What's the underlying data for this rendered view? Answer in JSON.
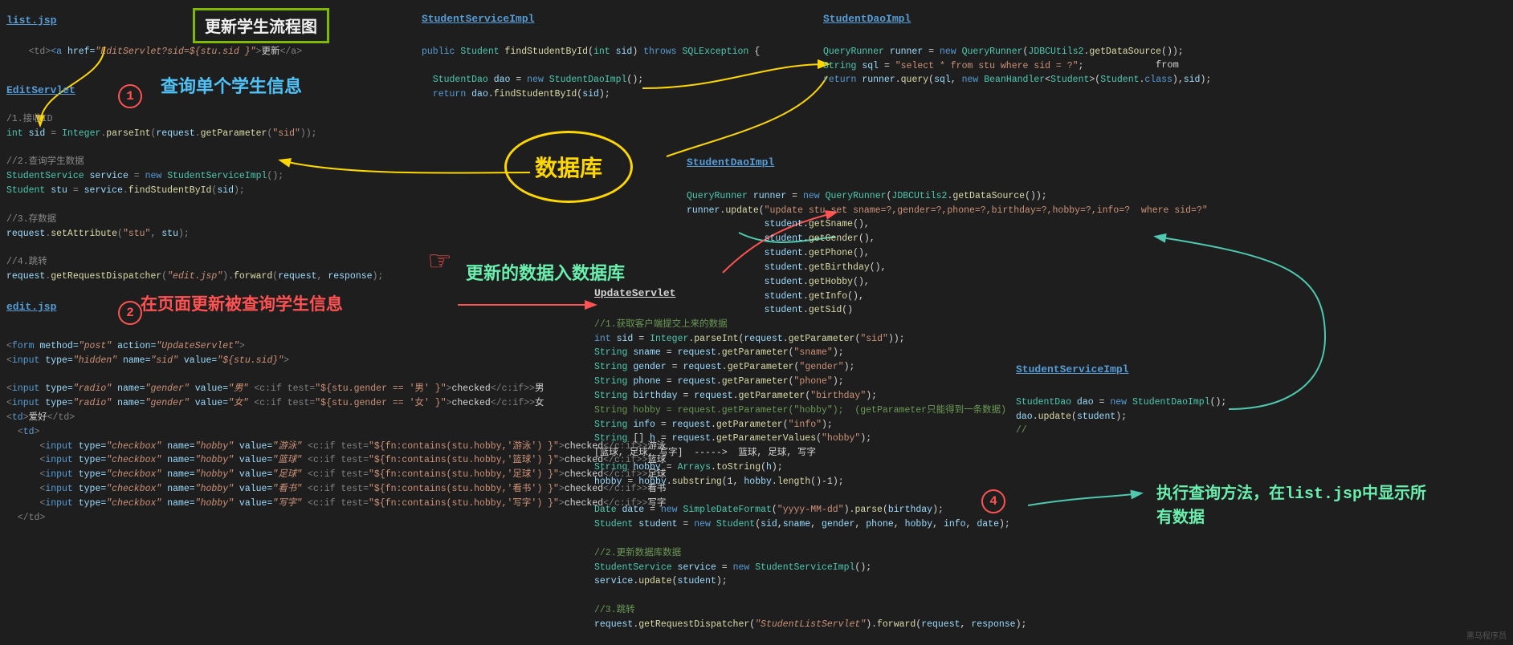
{
  "title": "更新学生流程图",
  "sections": {
    "list_jsp": {
      "label": "list.jsp",
      "code_line": "<td><a href=\"EditServlet?sid=${stu.sid }\">更新</a>"
    },
    "edit_servlet": {
      "label": "EditServlet",
      "subtitle": "查询单个学生信息",
      "code": "/1.接收ID\nint sid = Integer.parseInt(request.getParameter(\"sid\"));\n\n//2.查询学生数据\nStudentService service = new StudentServiceImpl();\nStudent stu = service.findStudentById(sid);\n\n//3.存数据\nrequest.setAttribute(\"stu\", stu);\n\n//4.跳转\nrequest.getRequestDispatcher(\"edit.jsp\").forward(request, response);"
    },
    "student_service_impl_top": {
      "label": "StudentServiceImpl",
      "code": "public Student findStudentById(int sid) throws SQLException {\n\n    StudentDao dao = new StudentDaoImpl();\n    return dao.findStudentById(sid);"
    },
    "student_dao_impl_top": {
      "label": "StudentDaoImpl",
      "code_line1": "QueryRunner runner = new QueryRunner(JDBCUtils2.getDataSource());",
      "code_line2": "String sql = \"select * from stu where sid = ?\";",
      "code_line3": "return runner.query(sql, new BeanHandler<Student>(Student.class),sid);"
    },
    "database": "数据库",
    "student_dao_impl_bottom": {
      "label": "StudentDaoImpl",
      "code_line1": "QueryRunner runner = new QueryRunner(JDBCUtils2.getDataSource());",
      "code_line2": "runner.update(\"update stu set sname=?,gender=?,phone=?,birthday=?,hobby=?,info=?  where sid=?\"",
      "code_methods": "student.getSname(),\nstudent.getGender(),\nstudent.getPhone(),\nstudent.getBirthday(),\nstudent.getHobby(),\nstudent.getInfo(),\nstudent.getSid()"
    },
    "update_data_heading": "更新的数据入数据库",
    "update_servlet": {
      "label": "UpdateServlet",
      "comment1": "//1.获取客户端提交上来的数据",
      "code1": "int sid = Integer.parseInt(request.getParameter(\"sid\"));\nString sname = request.getParameter(\"sname\");\nString gender = request.getParameter(\"gender\");\nString phone = request.getParameter(\"phone\");\nString birthday = request.getParameter(\"birthday\");",
      "comment2": "String hobby = request.getParameter(\"hobby\");  (getParameter只能得到一条数据)",
      "code2": "String info = request.getParameter(\"info\");\nString [] h = request.getParameterValues(\"hobby\");\n[篮球, 足球, 写字]  ----->  篮球, 足球, 写字\nString hobby = Arrays.toString(h);\nhobby = hobby.substring(1, hobby.length()-1);",
      "code3": "Date date = new SimpleDateFormat(\"yyyy-MM-dd\").parse(birthday);\nStudent student = new Student(sid,sname, gender, phone, hobby, info, date);",
      "comment3": "//2.更新数据库数据",
      "code4": "StudentService service = new StudentServiceImpl();\nservice.update(student);",
      "comment4": "//3.跳转",
      "code5": "request.getRequestDispatcher(\"StudentListServlet\").forward(request, response);"
    },
    "student_service_impl_bottom": {
      "label": "StudentServiceImpl",
      "code": "StudentDao dao = new StudentDaoImpl();\ndao.update(student);",
      "comment": "//"
    },
    "execute_heading": "执行查询方法，在list.jsp中显示所\n有数据",
    "edit_jsp": {
      "label": "edit.jsp",
      "subtitle": "在页面更新被查询学生信息",
      "code1": "<form method=\"post\" action=\"UpdateServlet\">",
      "code2": "<input type=\"hidden\" name=\"sid\" value=\"${stu.sid}\">",
      "code3": "<input type=\"radio\" name=\"gender\" value=\"男\" <c:if test=\"${stu.gender == '男' }\">checked</c:if>>男\n<input type=\"radio\" name=\"gender\" value=\"女\" <c:if test=\"${stu.gender == '女' }\">checked</c:if>>女",
      "code4": "<td>爱好</td>",
      "code5": "    <td>\n        <input type=\"checkbox\" name=\"hobby\" value=\"游泳\" <c:if test=\"${fn:contains(stu.hobby,'游泳') }\">checked</c:if>>游泳\n        <input type=\"checkbox\" name=\"hobby\" value=\"篮球\" <c:if test=\"${fn:contains(stu.hobby,'篮球') }\">checked</c:if>>篮球\n        <input type=\"checkbox\" name=\"hobby\" value=\"足球\" <c:if test=\"${fn:contains(stu.hobby,'足球') }\">checked</c:if>>足球\n        <input type=\"checkbox\" name=\"hobby\" value=\"看书\" <c:if test=\"${fn:contains(stu.hobby,'看书') }\">checked</c:if>>看书\n        <input type=\"checkbox\" name=\"hobby\" value=\"写字\" <c:if test=\"${fn:contains(stu.hobby,'写字') }\">checked</c:if>>写字\n    </td>"
    }
  }
}
